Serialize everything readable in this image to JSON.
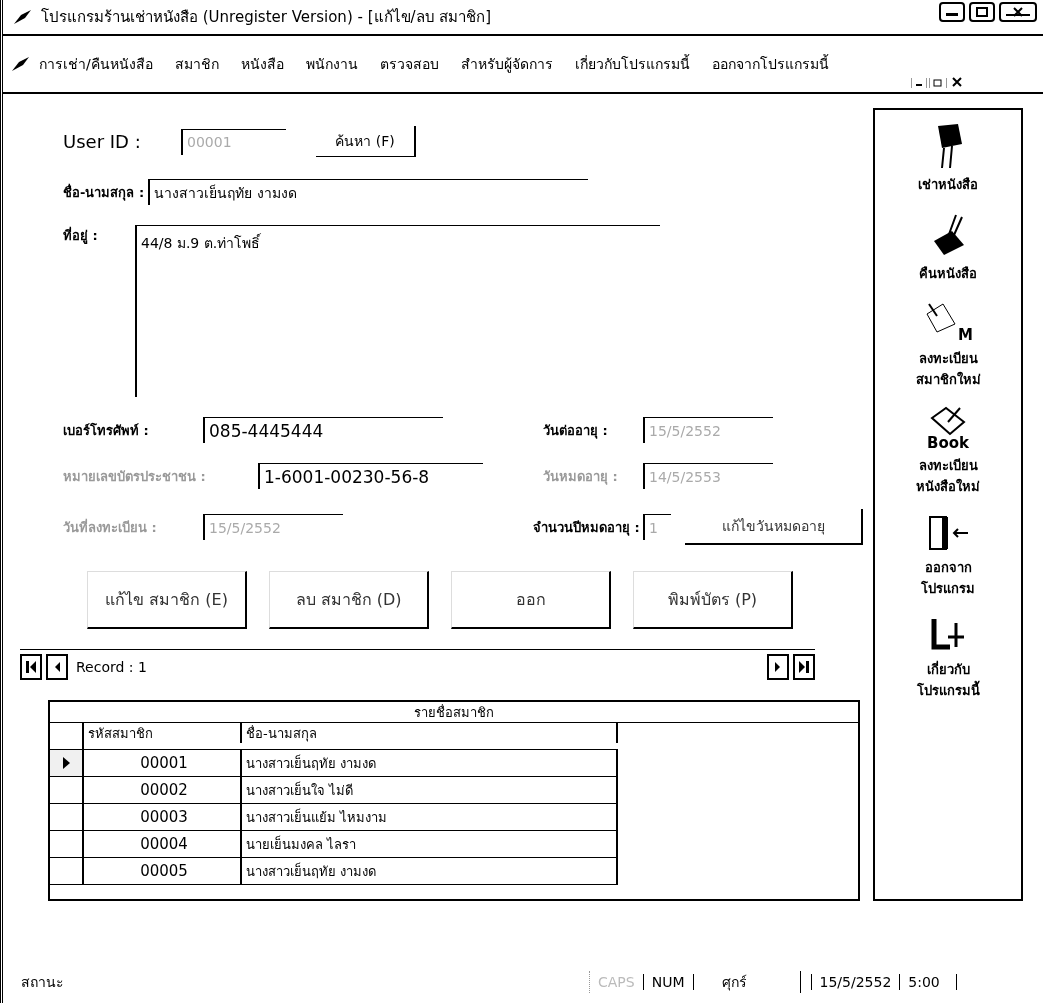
{
  "window": {
    "title": "โปรแกรมร้านเช่าหนังสือ (Unregister Version) - [แก้ไข/ลบ สมาชิก]"
  },
  "menu": [
    {
      "label": "การเช่า/คืนหนังสือ"
    },
    {
      "label": "สมาชิก"
    },
    {
      "label": "หนังสือ"
    },
    {
      "label": "พนักงาน"
    },
    {
      "label": "ตรวจสอบ"
    },
    {
      "label": "สำหรับผู้จัดการ"
    },
    {
      "label": "เกี่ยวกับโปรแกรมนี้"
    },
    {
      "label": "ออกจากโปรแกรมนี้"
    }
  ],
  "form": {
    "user_id": {
      "label": "User ID :",
      "value": "00001",
      "disabled": true,
      "dimmed": false
    },
    "search_button": "ค้นหา (F)",
    "name": {
      "label": "ชื่อ-นามสกุล :",
      "value": "นางสาวเย็นฤทัย งามงด",
      "disabled": false,
      "dimmed": false
    },
    "address": {
      "label": "ที่อยู่ :",
      "value": "44/8 ม.9 ต.ท่าโพธิ์",
      "disabled": false,
      "dimmed": false
    },
    "phone": {
      "label": "เบอร์โทรศัพท์ :",
      "value": "085-4445444",
      "disabled": false,
      "dimmed": false
    },
    "renew_date": {
      "label": "วันต่ออายุ :",
      "value": "15/5/2552",
      "disabled": true,
      "dimmed": false
    },
    "id_card": {
      "label": "หมายเลขบัตรประชาชน :",
      "value": "1-6001-00230-56-8",
      "disabled": false,
      "dimmed": true
    },
    "expire_date": {
      "label": "วันหมดอายุ :",
      "value": "14/5/2553",
      "disabled": true,
      "dimmed": true
    },
    "register_date": {
      "label": "วันที่ลงทะเบียน :",
      "value": "15/5/2552",
      "disabled": true,
      "dimmed": true
    },
    "years": {
      "label": "จำนวนปีหมดอายุ :",
      "value": "1",
      "disabled": true,
      "dimmed": false
    },
    "edit_expiry_button": "แก้ไขวันหมดอายุ",
    "buttons": [
      "แก้ไข สมาชิก (E)",
      "ลบ สมาชิก (D)",
      "ออก",
      "พิมพ์บัตร (P)"
    ]
  },
  "record_nav": {
    "label": "Record : 1"
  },
  "grid": {
    "title": "รายชื่อสมาชิก",
    "columns": [
      "รหัสสมาชิก",
      "ชื่อ-นามสกุล"
    ],
    "rows": [
      {
        "id": "00001",
        "name": "นางสาวเย็นฤทัย งามงด",
        "selected": true
      },
      {
        "id": "00002",
        "name": "นางสาวเย็นใจ ไม่ดี",
        "selected": false
      },
      {
        "id": "00003",
        "name": "นางสาวเย็นแย้ม ไหมงาม",
        "selected": false
      },
      {
        "id": "00004",
        "name": "นายเย็นมงคล ไลรา",
        "selected": false
      },
      {
        "id": "00005",
        "name": "นางสาวเย็นฤทัย งามงด",
        "selected": false
      }
    ]
  },
  "sidebar": {
    "items": [
      {
        "kind": "rent",
        "label": "เช่าหนังสือ"
      },
      {
        "kind": "return",
        "label": "คืนหนังสือ"
      },
      {
        "kind": "member",
        "label": "ลงทะเบียนสมาชิกใหม่",
        "badge": "M"
      },
      {
        "kind": "book",
        "label": "ลงทะเบียนหนังสือใหม่",
        "badge": "Book"
      },
      {
        "kind": "exit",
        "label": "ออกจากโปรแกรม"
      },
      {
        "kind": "about",
        "label": "เกี่ยวกับโปรแกรมนี้"
      }
    ]
  },
  "status_bar": [
    {
      "text": "สถานะ",
      "disabled": false
    },
    {
      "text": "CAPS",
      "disabled": true
    },
    {
      "text": "NUM",
      "disabled": false
    },
    {
      "text": "ศุกร์",
      "disabled": false
    },
    {
      "text": "15/5/2552",
      "disabled": false
    },
    {
      "text": "5:00",
      "disabled": false
    }
  ]
}
